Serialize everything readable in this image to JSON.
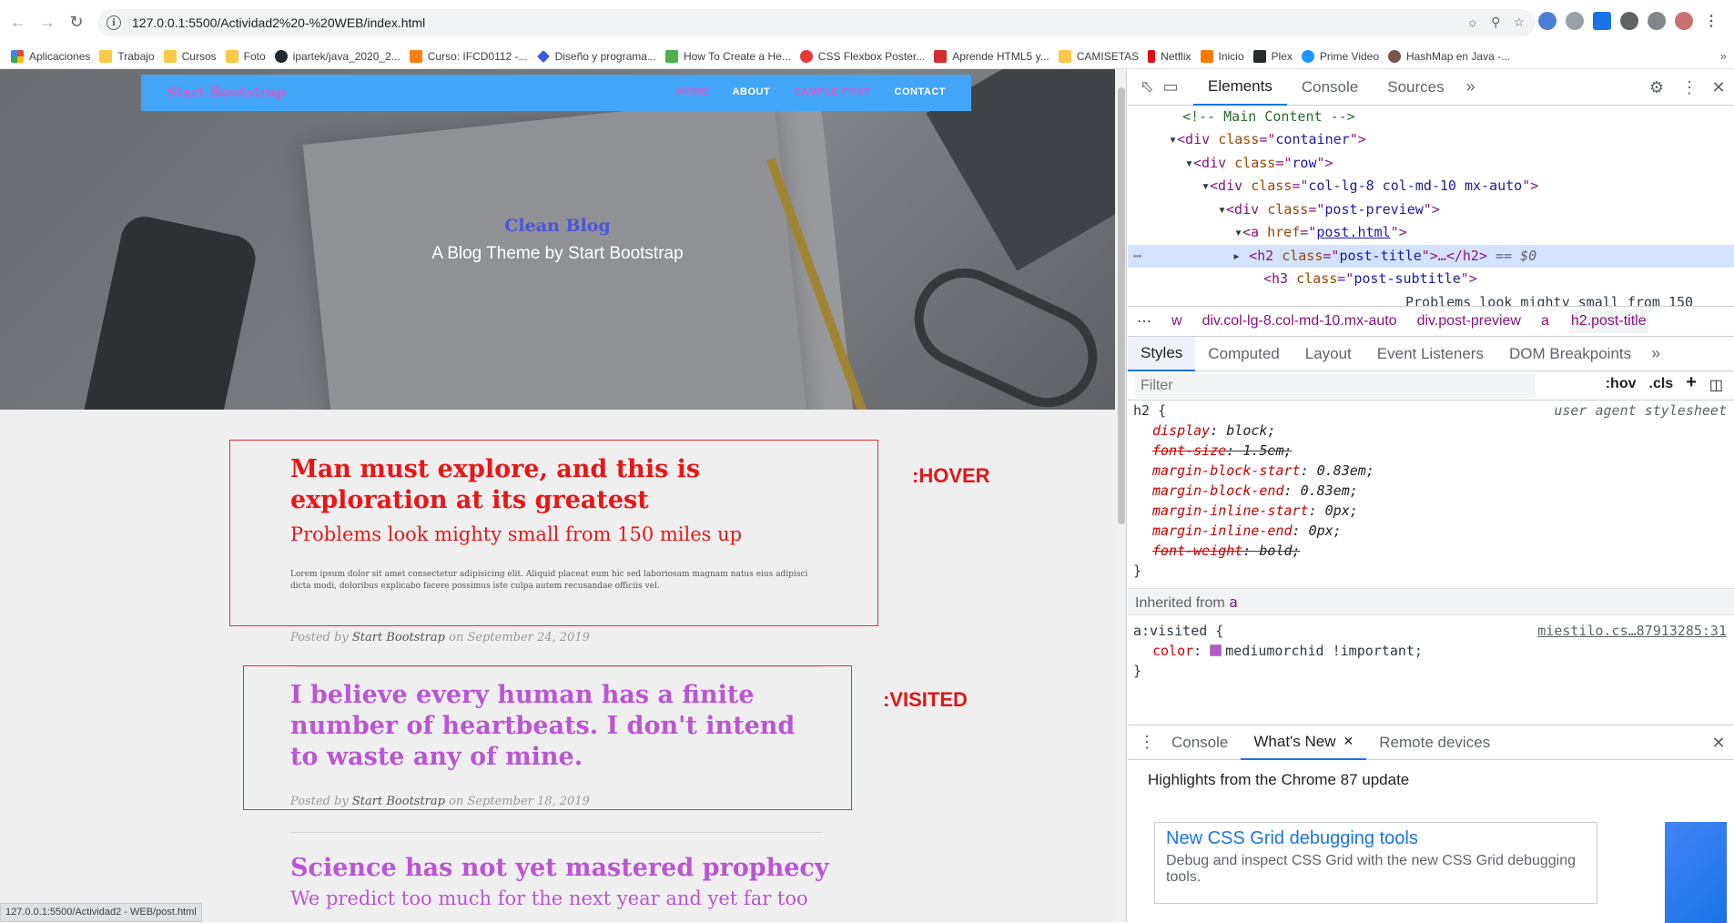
{
  "browser": {
    "url": "127.0.0.1:5500/Actividad2%20-%20WEB/index.html",
    "status_url": "127.0.0.1:5500/Actividad2 - WEB/post.html"
  },
  "bookmarks": [
    {
      "label": "Aplicaciones",
      "icon": "apps-grid-icon"
    },
    {
      "label": "Trabajo",
      "icon": "folder-icon"
    },
    {
      "label": "Cursos",
      "icon": "folder-icon"
    },
    {
      "label": "Foto",
      "icon": "folder-icon"
    },
    {
      "label": "ipartek/java_2020_2...",
      "icon": "github-icon"
    },
    {
      "label": "Curso: IFCD0112 -...",
      "icon": "moodle-icon"
    },
    {
      "label": "Diseño y programa...",
      "icon": "diamond-icon"
    },
    {
      "label": "How To Create a He...",
      "icon": "site-icon"
    },
    {
      "label": "CSS Flexbox Poster...",
      "icon": "site-icon"
    },
    {
      "label": "Aprende HTML5 y...",
      "icon": "site-icon"
    },
    {
      "label": "CAMISETAS",
      "icon": "folder-icon"
    },
    {
      "label": "Netflix",
      "icon": "netflix-icon"
    },
    {
      "label": "Inicio",
      "icon": "site-icon"
    },
    {
      "label": "Plex",
      "icon": "plex-icon"
    },
    {
      "label": "Prime Video",
      "icon": "prime-icon"
    },
    {
      "label": "HashMap en Java -...",
      "icon": "site-icon"
    }
  ],
  "site": {
    "brand": "Start Bootstrap",
    "nav": [
      {
        "label": "HOME",
        "color": "#d15cd1"
      },
      {
        "label": "ABOUT",
        "color": "#ffffff"
      },
      {
        "label": "SAMPLE POST",
        "color": "#d15cd1"
      },
      {
        "label": "CONTACT",
        "color": "#ffffff"
      }
    ],
    "hero_title": "Clean Blog",
    "hero_subtitle": "A Blog Theme by Start Bootstrap",
    "posts": [
      {
        "title": "Man must explore, and this is exploration at its greatest",
        "subtitle": "Problems look mighty small from 150 miles up",
        "excerpt": "Lorem ipsum dolor sit amet consectetur adipisicing elit. Aliquid placeat eum hic sed laboriosam magnam natus eius adipisci dicta modi, doloribus explicabo facere possimus iste culpa autem recusandae officiis vel.",
        "posted_by": "Posted by",
        "author": "Start Bootstrap",
        "date": "on September 24, 2019"
      },
      {
        "title": "I believe every human has a finite number of heartbeats. I don't intend to waste any of mine.",
        "posted_by": "Posted by",
        "author": "Start Bootstrap",
        "date": "on September 18, 2019"
      },
      {
        "title": "Science has not yet mastered prophecy",
        "subtitle": "We predict too much for the next year and yet far too"
      }
    ],
    "annotations": {
      "hover": ":HOVER",
      "visited": ":VISITED"
    }
  },
  "devtools": {
    "tabs": [
      "Elements",
      "Console",
      "Sources"
    ],
    "dom_lines": {
      "comment": "<!-- Main Content -->",
      "container": "container",
      "row": "row",
      "col": "col-lg-8 col-md-10 mx-auto",
      "preview": "post-preview",
      "href": "post.html",
      "h2cls": "post-title",
      "h3cls": "post-subtitle",
      "text_clip": "Problems look mighty small from 150"
    },
    "crumbs": [
      "w",
      "div.col-lg-8.col-md-10.mx-auto",
      "div.post-preview",
      "a",
      "h2.post-title"
    ],
    "subtabs": [
      "Styles",
      "Computed",
      "Layout",
      "Event Listeners",
      "DOM Breakpoints"
    ],
    "filter_placeholder": "Filter",
    "filter_tools": [
      ":hov",
      ".cls",
      "+"
    ],
    "h2_rule": {
      "selector": "h2",
      "source": "user agent stylesheet",
      "props": [
        {
          "name": "display",
          "value": "block;",
          "strike": false
        },
        {
          "name": "font-size",
          "value": "1.5em;",
          "strike": true
        },
        {
          "name": "margin-block-start",
          "value": "0.83em;",
          "strike": false
        },
        {
          "name": "margin-block-end",
          "value": "0.83em;",
          "strike": false
        },
        {
          "name": "margin-inline-start",
          "value": "0px;",
          "strike": false
        },
        {
          "name": "margin-inline-end",
          "value": "0px;",
          "strike": false
        },
        {
          "name": "font-weight",
          "value": "bold;",
          "strike": true
        }
      ]
    },
    "inherited_label": "Inherited from",
    "inherited_from": "a",
    "visited_rule": {
      "selector": "a:visited",
      "source": "miestilo.cs…87913285:31",
      "prop": "color",
      "value": "mediumorchid !important;"
    },
    "drawer_tabs": [
      "Console",
      "What's New",
      "Remote devices"
    ],
    "highlights": "Highlights from the Chrome 87 update",
    "card": {
      "title": "New CSS Grid debugging tools",
      "desc": "Debug and inspect CSS Grid with the new CSS Grid debugging tools."
    }
  }
}
